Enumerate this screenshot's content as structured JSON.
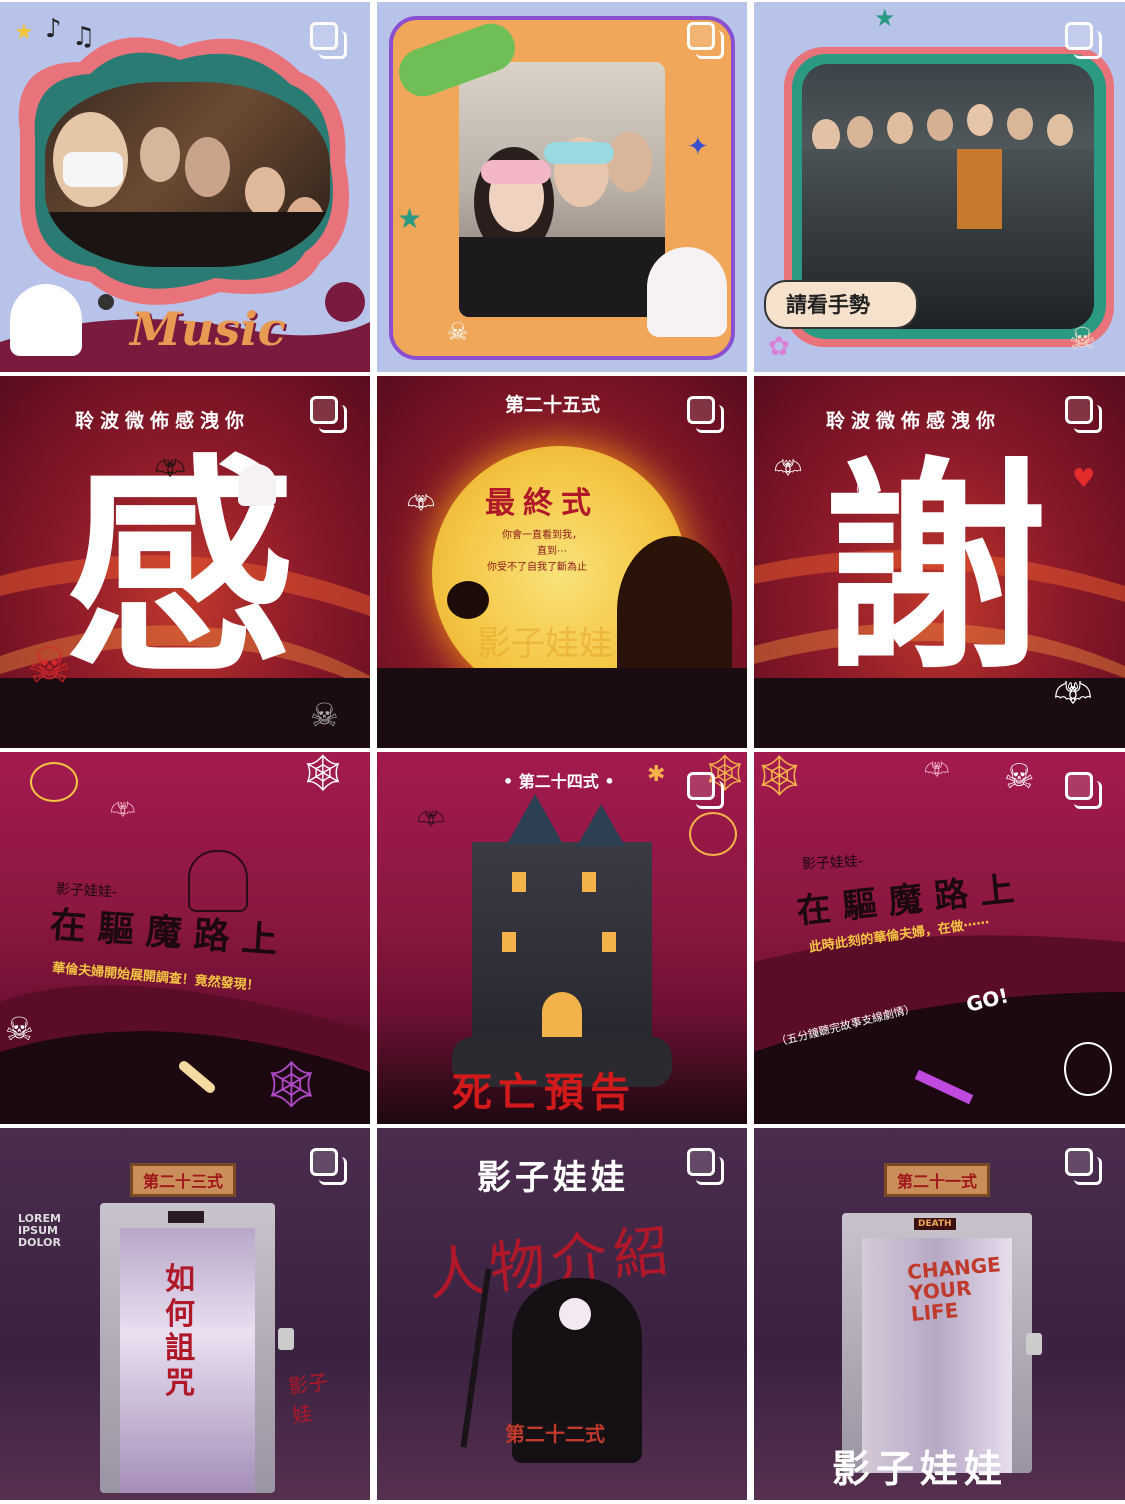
{
  "tiles": [
    {
      "id": "music",
      "caption": "Music",
      "colors": {
        "bg": "#b8c3ea",
        "frame": "#e8737a",
        "accent": "#2a7b74"
      }
    },
    {
      "id": "glasses",
      "colors": {
        "bg": "#b8c3ea",
        "frame": "#8a4fd0",
        "accent": "#f0a75a"
      }
    },
    {
      "id": "group",
      "caption": "請看手勢",
      "colors": {
        "bg": "#b8c3ea",
        "frame": "#e8737a",
        "accent": "#2a7b74"
      }
    },
    {
      "id": "gan",
      "top_text": "聆波微佈感洩你",
      "big_char": "感"
    },
    {
      "id": "final",
      "top_text": "第二十五式",
      "title": "最終式",
      "lines": [
        "你會一直看到我，",
        "直到⋯",
        "你受不了自我了斷為止"
      ],
      "watermark": "影子娃娃"
    },
    {
      "id": "xie",
      "top_text": "聆波微佈感洩你",
      "big_char": "謝"
    },
    {
      "id": "exorcism1",
      "sub": "影子娃娃-",
      "title": "在驅魔路上",
      "line": "華倫夫婦開始展開調查！竟然發現！"
    },
    {
      "id": "death",
      "top_text": "• 第二十四式 •",
      "title": "死亡預告"
    },
    {
      "id": "exorcism2",
      "sub": "影子娃娃-",
      "title": "在驅魔路上",
      "line": "此時此刻的華倫夫婦，在做⋯⋯",
      "note": "（五分鐘聽完故事支線劇情）",
      "go": "GO!"
    },
    {
      "id": "curse",
      "plaque": "第二十三式",
      "wall_text": "LOREM IPSUM DOLOR",
      "door_text": "如何詛咒",
      "side_text": "影子娃"
    },
    {
      "id": "intro",
      "top_text": "影子娃娃",
      "scrawl": "人物介紹",
      "bottom_text": "第二十二式"
    },
    {
      "id": "change",
      "plaque": "第二十一式",
      "sign": "DEATH",
      "door_text": "CHANGE YOUR LIFE",
      "bottom_text": "影子娃娃"
    }
  ]
}
